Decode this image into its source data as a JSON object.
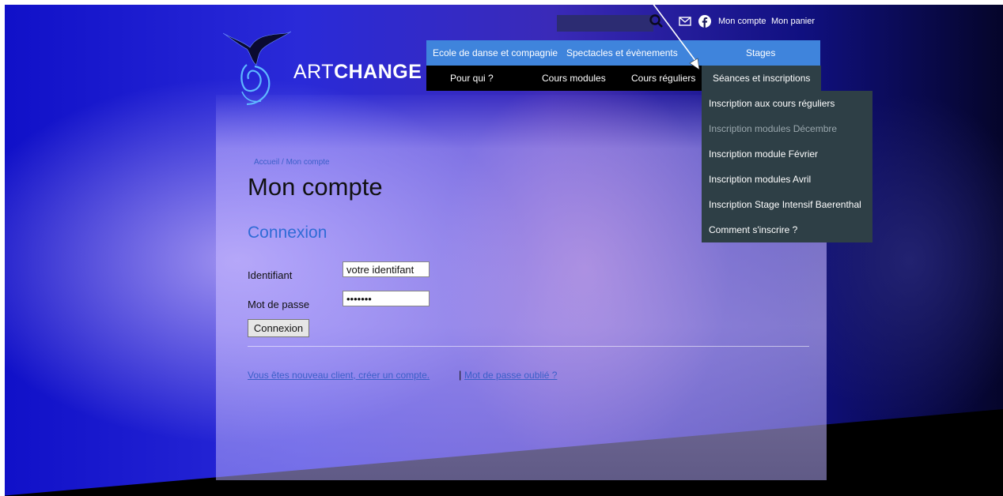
{
  "brand": {
    "part1": "ART",
    "part2": "CHANGE"
  },
  "topbar": {
    "search_placeholder": "",
    "account_link": "Mon compte",
    "cart_link": "Mon panier"
  },
  "nav": {
    "main": [
      "Ecole de danse et compagnie",
      "Spectacles et évènements",
      "Stages"
    ],
    "sub": [
      "Pour qui ?",
      "Cours modules",
      "Cours réguliers",
      "Séances et inscriptions"
    ]
  },
  "dropdown": [
    "Inscription aux cours réguliers",
    "Inscription modules Décembre",
    "Inscription module Février",
    "Inscription modules Avril",
    "Inscription Stage Intensif Baerenthal",
    "Comment s'inscrire ?"
  ],
  "breadcrumb": {
    "home": "Accueil",
    "sep": "/",
    "current": "Mon compte"
  },
  "page_title": "Mon compte",
  "login": {
    "title": "Connexion",
    "username_label": "Identifiant",
    "username_value": "votre identifant",
    "password_label": "Mot de passe",
    "password_value": "•••••••",
    "submit_label": "Connexion"
  },
  "links": {
    "new_account": "Vous êtes nouveau client, créer un compte.",
    "separator": "|",
    "forgot": "Mot de passe oublié ?"
  },
  "colors": {
    "nav_main": "#3f84dc",
    "nav_sub": "#000000",
    "dropdown": "#2e3f46",
    "accent": "#2f6bd6"
  }
}
